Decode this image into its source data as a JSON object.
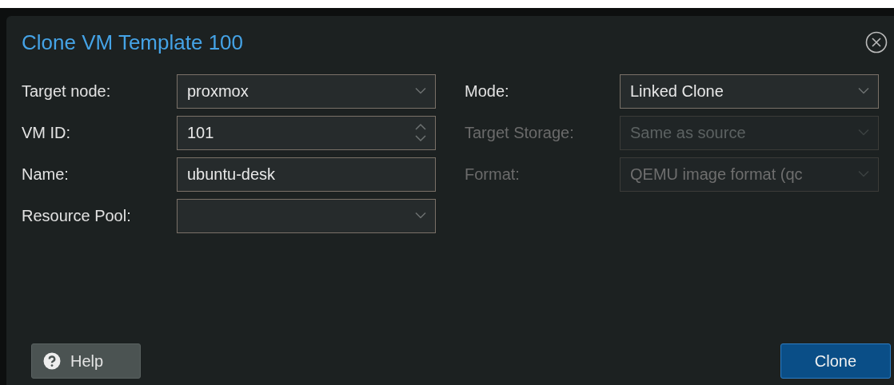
{
  "dialog": {
    "title": "Clone VM Template 100"
  },
  "left_fields": [
    {
      "label": "Target node:",
      "kind": "combo",
      "value": "proxmox",
      "disabled": false
    },
    {
      "label": "VM ID:",
      "kind": "spinner",
      "value": "101",
      "disabled": false
    },
    {
      "label": "Name:",
      "kind": "text",
      "value": "ubuntu-desk",
      "disabled": false
    },
    {
      "label": "Resource Pool:",
      "kind": "combo",
      "disabled": false
    }
  ],
  "right_fields": [
    {
      "label": "Mode:",
      "kind": "combo",
      "value": "Linked Clone",
      "disabled": false
    },
    {
      "label": "Target Storage:",
      "kind": "combo",
      "placeholder": "Same as source",
      "disabled": true
    },
    {
      "label": "Format:",
      "kind": "combo",
      "value": "QEMU image format (qc",
      "disabled": true
    }
  ],
  "buttons": [
    {
      "label": "Help",
      "kind": "help"
    },
    {
      "label": "Clone",
      "kind": "primary"
    }
  ]
}
